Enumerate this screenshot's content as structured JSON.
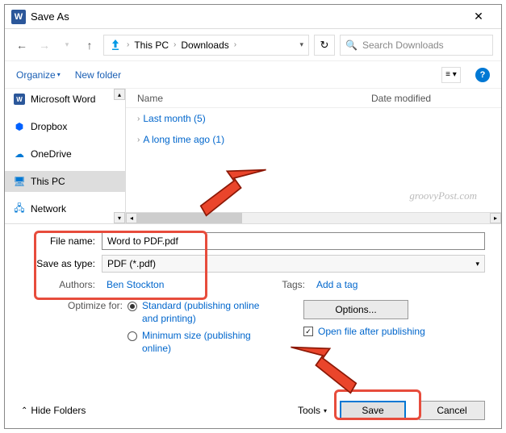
{
  "title": "Save As",
  "breadcrumb": {
    "item1": "This PC",
    "item2": "Downloads"
  },
  "search_placeholder": "Search Downloads",
  "toolbar": {
    "organize": "Organize",
    "new_folder": "New folder"
  },
  "sidebar": {
    "items": [
      {
        "label": "Microsoft Word",
        "icon": "word"
      },
      {
        "label": "Dropbox",
        "icon": "dropbox"
      },
      {
        "label": "OneDrive",
        "icon": "onedrive"
      },
      {
        "label": "This PC",
        "icon": "thispc",
        "selected": true
      },
      {
        "label": "Network",
        "icon": "network"
      }
    ]
  },
  "fileview": {
    "col_name": "Name",
    "col_date": "Date modified",
    "groups": [
      {
        "label": "Last month (5)"
      },
      {
        "label": "A long time ago (1)"
      }
    ]
  },
  "watermark": "groovyPost.com",
  "form": {
    "file_name_label": "File name:",
    "file_name_value": "Word to PDF.pdf",
    "save_type_label": "Save as type:",
    "save_type_value": "PDF (*.pdf)",
    "authors_label": "Authors:",
    "authors_value": "Ben Stockton",
    "tags_label": "Tags:",
    "tags_value": "Add a tag"
  },
  "optimize": {
    "label": "Optimize for:",
    "standard": "Standard (publishing online and printing)",
    "minimum": "Minimum size (publishing online)"
  },
  "options_btn": "Options...",
  "open_after": "Open file after publishing",
  "hide_folders": "Hide Folders",
  "tools": "Tools",
  "save": "Save",
  "cancel": "Cancel"
}
